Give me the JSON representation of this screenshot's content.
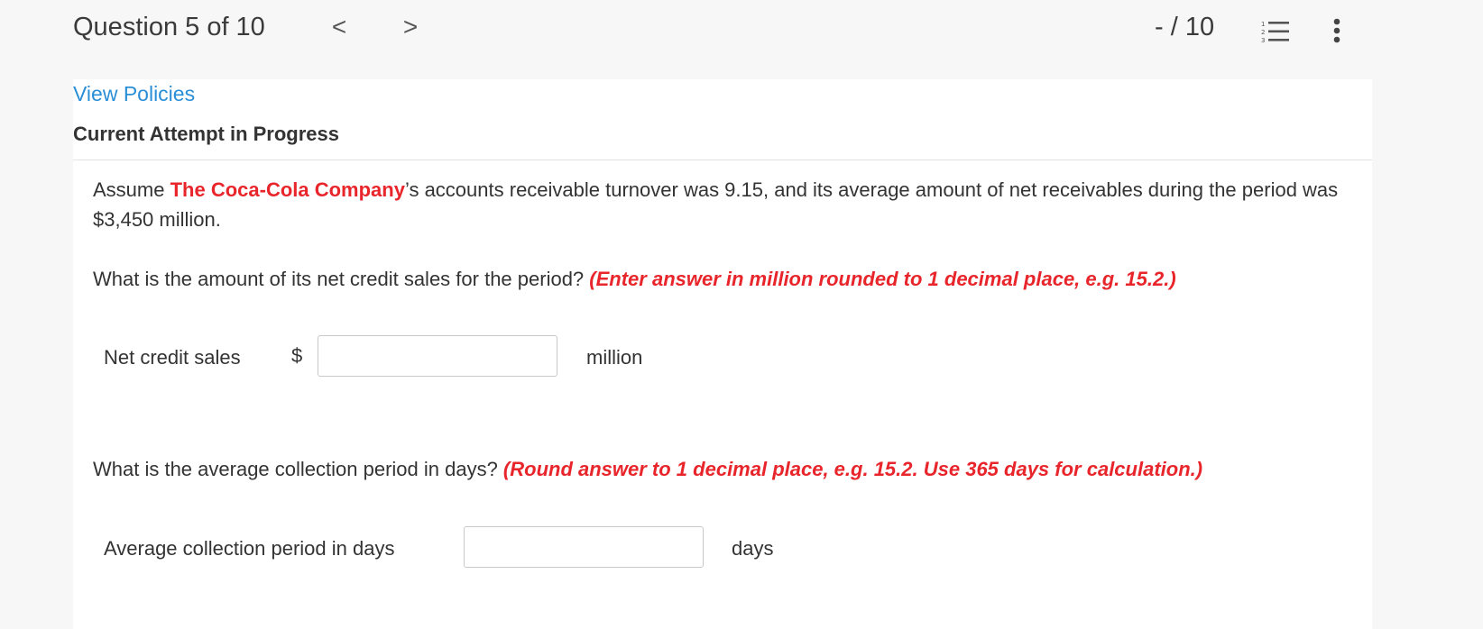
{
  "header": {
    "question_label": "Question 5 of 10",
    "prev_arrow": "<",
    "next_arrow": ">",
    "score": "- / 10",
    "list_icon": "numbered-list-icon",
    "more_icon": "more-vertical-icon"
  },
  "policies_link": "View Policies",
  "attempt_heading": "Current Attempt in Progress",
  "question": {
    "intro_prefix": "Assume ",
    "company": "The Coca-Cola Company",
    "intro_suffix": "’s accounts receivable turnover was 9.15, and its average amount of net receivables during the period was $3,450 million.",
    "q1_text": "What is the amount of its net credit sales for the period? ",
    "q1_instruction": "(Enter answer in million rounded to 1 decimal place, e.g. 15.2.)",
    "q2_text": "What is the average collection period in days? ",
    "q2_instruction": "(Round answer to 1 decimal place, e.g. 15.2. Use 365 days for calculation.)"
  },
  "inputs": {
    "net_credit_sales": {
      "label": "Net credit sales",
      "prefix": "$",
      "value": "",
      "suffix": "million"
    },
    "collection_period": {
      "label": "Average collection period in days",
      "value": "",
      "suffix": "days"
    }
  },
  "colors": {
    "link": "#2a8fd6",
    "emphasis_red": "#e8252b",
    "panel_bg": "#ffffff",
    "page_bg": "#f7f7f7"
  }
}
